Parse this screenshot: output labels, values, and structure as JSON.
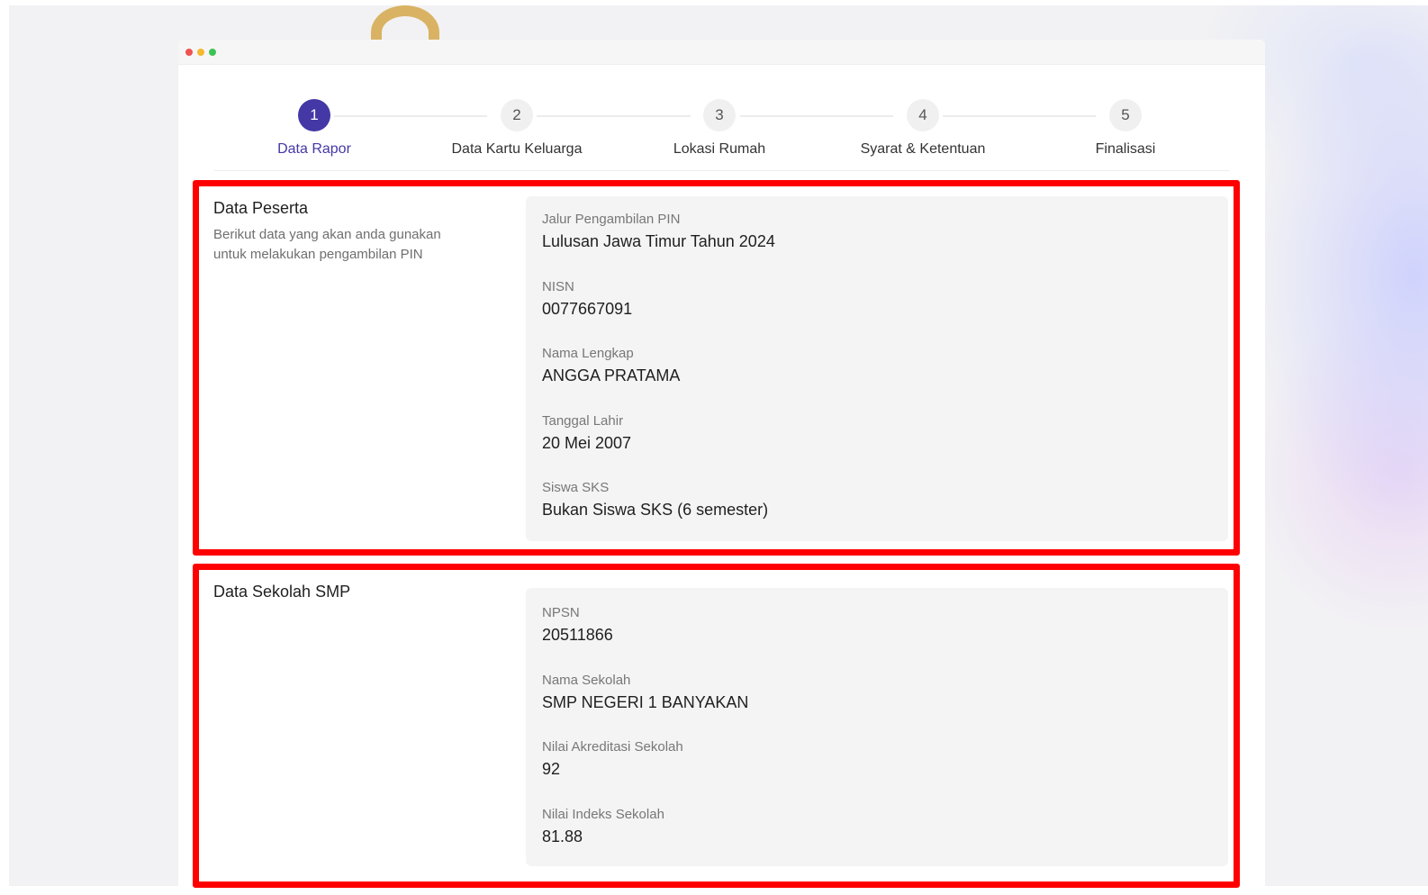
{
  "stepper": {
    "steps": [
      {
        "number": "1",
        "label": "Data Rapor",
        "active": true
      },
      {
        "number": "2",
        "label": "Data Kartu Keluarga",
        "active": false
      },
      {
        "number": "3",
        "label": "Lokasi Rumah",
        "active": false
      },
      {
        "number": "4",
        "label": "Syarat & Ketentuan",
        "active": false
      },
      {
        "number": "5",
        "label": "Finalisasi",
        "active": false
      }
    ]
  },
  "data_peserta": {
    "title": "Data Peserta",
    "description": "Berikut data yang akan anda gunakan untuk melakukan pengambilan PIN",
    "fields": [
      {
        "label": "Jalur Pengambilan PIN",
        "value": "Lulusan Jawa Timur Tahun 2024"
      },
      {
        "label": "NISN",
        "value": "0077667091"
      },
      {
        "label": "Nama Lengkap",
        "value": "ANGGA PRATAMA"
      },
      {
        "label": "Tanggal Lahir",
        "value": "20 Mei 2007"
      },
      {
        "label": "Siswa SKS",
        "value": "Bukan Siswa SKS (6 semester)"
      }
    ]
  },
  "data_sekolah": {
    "title": "Data Sekolah SMP",
    "fields": [
      {
        "label": "NPSN",
        "value": "20511866"
      },
      {
        "label": "Nama Sekolah",
        "value": "SMP NEGERI 1 BANYAKAN"
      },
      {
        "label": "Nilai Akreditasi Sekolah",
        "value": "92"
      },
      {
        "label": "Nilai Indeks Sekolah",
        "value": "81.88"
      }
    ]
  },
  "colors": {
    "accent": "#4438a6",
    "highlight_border": "#ff0000",
    "panel_bg": "#f4f4f5"
  }
}
